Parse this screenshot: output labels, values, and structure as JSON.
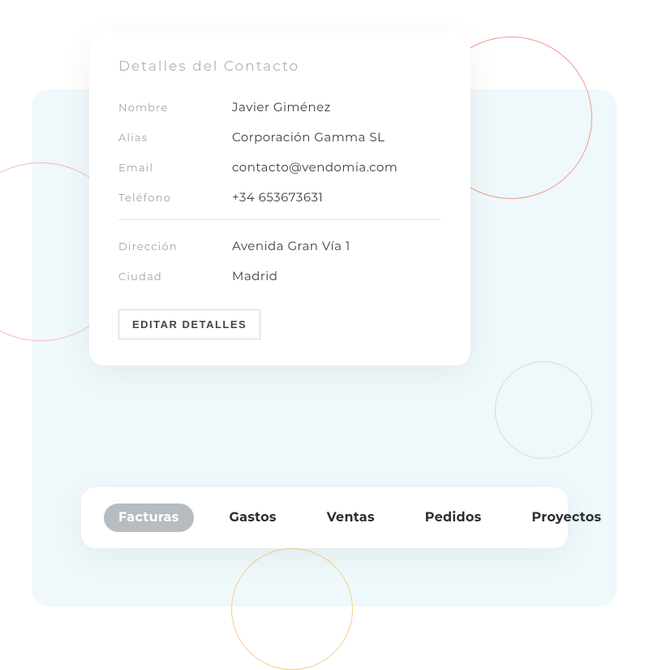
{
  "details": {
    "title": "Detalles del Contacto",
    "fields": {
      "name": {
        "label": "Nombre",
        "value": "Javier Giménez"
      },
      "alias": {
        "label": "Alias",
        "value": "Corporación Gamma SL"
      },
      "email": {
        "label": "Email",
        "value": "contacto@vendomia.com"
      },
      "phone": {
        "label": "Teléfono",
        "value": "+34 653673631"
      },
      "address": {
        "label": "Dirección",
        "value": "Avenida Gran Vía 1"
      },
      "city": {
        "label": "Ciudad",
        "value": "Madrid"
      }
    },
    "edit_button": "EDITAR DETALLES"
  },
  "tabs": {
    "items": [
      {
        "label": "Facturas",
        "active": true
      },
      {
        "label": "Gastos",
        "active": false
      },
      {
        "label": "Ventas",
        "active": false
      },
      {
        "label": "Pedidos",
        "active": false
      },
      {
        "label": "Proyectos",
        "active": false
      }
    ]
  }
}
